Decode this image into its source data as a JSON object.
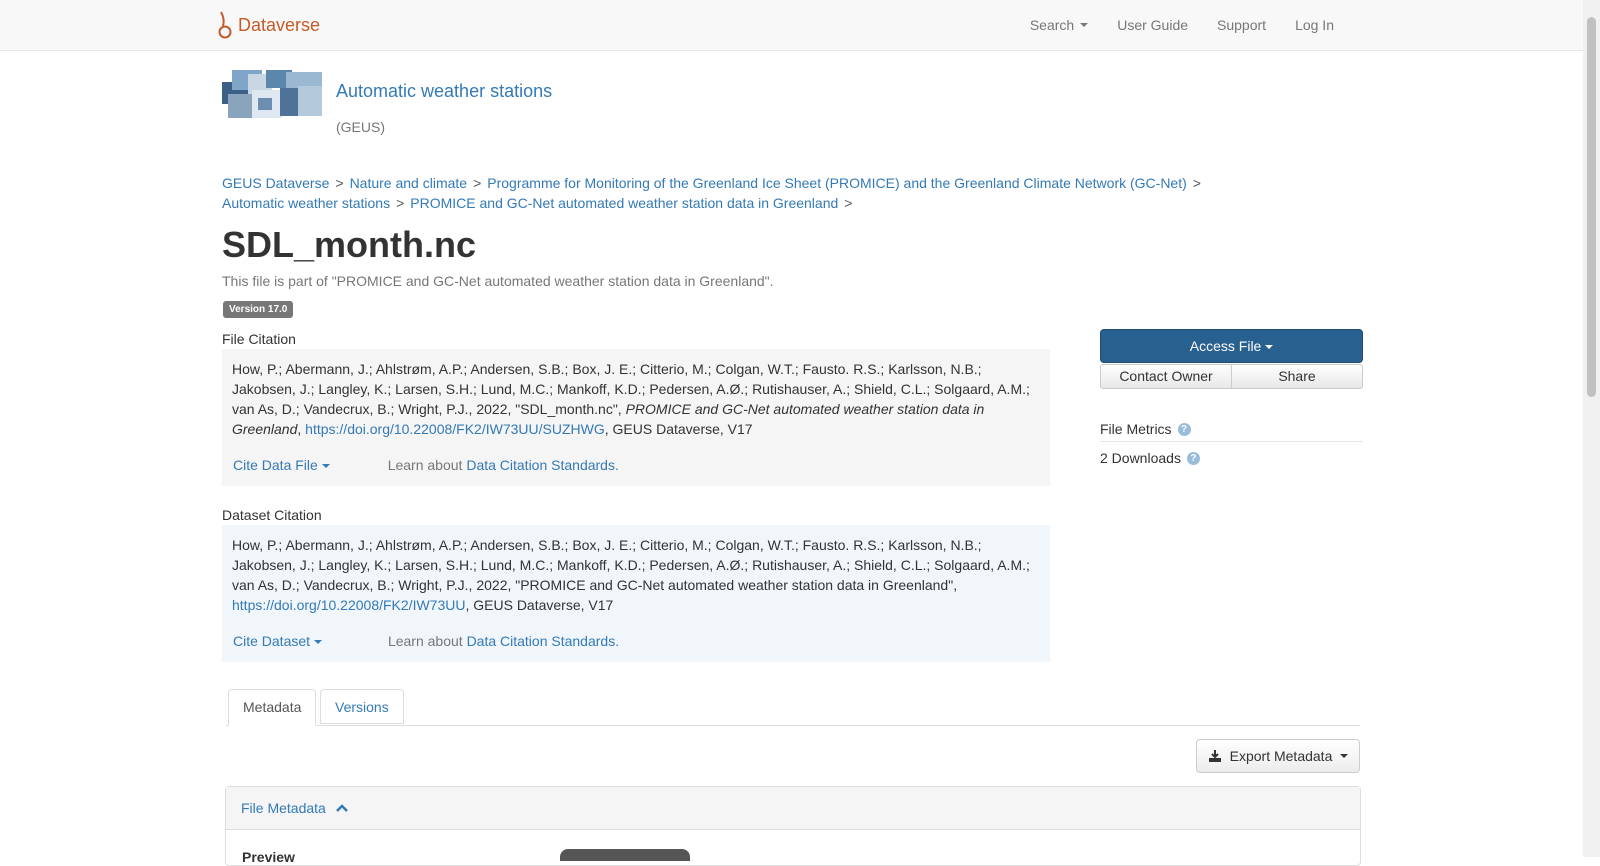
{
  "navbar": {
    "brand": "Dataverse",
    "search": "Search",
    "user_guide": "User Guide",
    "support": "Support",
    "login": "Log In"
  },
  "dataverse": {
    "name": "Automatic weather stations",
    "affiliation": "(GEUS)"
  },
  "breadcrumb": [
    "GEUS Dataverse",
    "Nature and climate",
    "Programme for Monitoring of the Greenland Ice Sheet (PROMICE) and the Greenland Climate Network (GC-Net)",
    "Automatic weather stations",
    "PROMICE and GC-Net automated weather station data in Greenland"
  ],
  "breadcrumb_sep": ">",
  "file": {
    "title": "SDL_month.nc",
    "part_of": "This file is part of \"PROMICE and GC-Net automated weather station data in Greenland\".",
    "version": "Version 17.0"
  },
  "file_citation": {
    "label": "File Citation",
    "authors": "How, P.; Abermann, J.; Ahlstrøm, A.P.; Andersen, S.B.; Box, J. E.; Citterio, M.; Colgan, W.T.; Fausto. R.S.; Karlsson, N.B.; Jakobsen, J.; Langley, K.; Larsen, S.H.; Lund, M.C.; Mankoff, K.D.; Pedersen, A.Ø.; Rutishauser, A.; Shield, C.L.; Solgaard, A.M.; van As, D.; Vandecrux, B.; Wright, P.J., 2022, \"SDL_month.nc\", ",
    "dataset_italic": "PROMICE and GC-Net automated weather station data in Greenland",
    "comma": ",",
    "doi": "https://doi.org/10.22008/FK2/IW73UU/SUZHWG",
    "suffix": ", GEUS Dataverse, V17",
    "cite_button": "Cite Data File",
    "learn_about": "Learn about",
    "standards_link": "Data Citation Standards."
  },
  "dataset_citation": {
    "label": "Dataset Citation",
    "authors": "How, P.; Abermann, J.; Ahlstrøm, A.P.; Andersen, S.B.; Box, J. E.; Citterio, M.; Colgan, W.T.; Fausto. R.S.; Karlsson, N.B.; Jakobsen, J.; Langley, K.; Larsen, S.H.; Lund, M.C.; Mankoff, K.D.; Pedersen, A.Ø.; Rutishauser, A.; Shield, C.L.; Solgaard, A.M.; van As, D.; Vandecrux, B.; Wright, P.J., 2022, \"PROMICE and GC-Net automated weather station data in Greenland\", ",
    "doi": "https://doi.org/10.22008/FK2/IW73UU",
    "suffix": ", GEUS Dataverse, V17",
    "cite_button": "Cite Dataset",
    "learn_about": "Learn about",
    "standards_link": "Data Citation Standards."
  },
  "actions": {
    "access_file": "Access File",
    "contact_owner": "Contact Owner",
    "share": "Share"
  },
  "metrics": {
    "heading": "File Metrics",
    "downloads": "2 Downloads"
  },
  "tabs": [
    "Metadata",
    "Versions"
  ],
  "export_metadata": "Export Metadata",
  "panel": {
    "heading": "File Metadata",
    "preview_label": "Preview"
  },
  "colors": {
    "link": "#337ab7",
    "brand": "#c55b28",
    "primary_button": "#286090"
  }
}
